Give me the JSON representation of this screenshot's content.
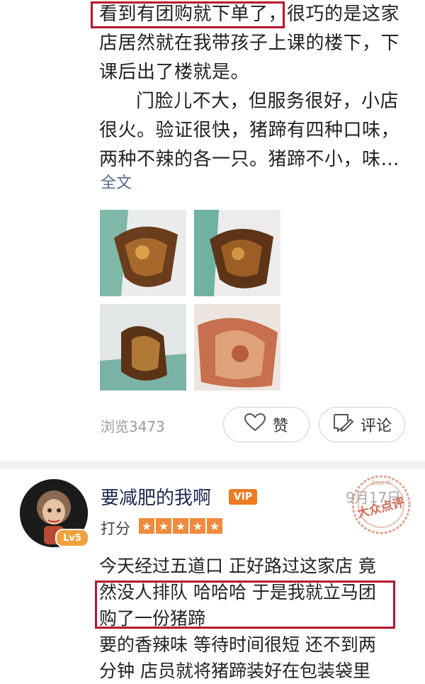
{
  "review": {
    "line1": "看到有团购就下单了，很巧的是这家",
    "line2": "店居然就在我带孩子上课的楼下，下",
    "line3": "课后出了楼就是。",
    "line4": "门脸儿不大，但服务很好，小店",
    "line5": "很火。验证很快，猪蹄有四种口味，",
    "line6": "两种不辣的各一只。猪蹄不小，味…",
    "full_text_link": "全文",
    "views": "浏览3473",
    "like_label": "赞",
    "comment_label": "评论"
  },
  "next_review": {
    "username": "要减肥的我啊",
    "vip_badge": "VIP",
    "level_badge": "Lv5",
    "date": "9月17日",
    "stamp_text": "大众点评",
    "stamp_top": "Dian Pi",
    "rating_label": "打分",
    "stars": 5,
    "line1": "今天经过五道口 正好路过这家店 竟",
    "line2": "然没人排队 哈哈哈 于是我就立马团",
    "line3": "购了一份猪蹄",
    "line4": "要的香辣味 等待时间很短 还不到两",
    "line5": "分钟 店员就将猪蹄装好在包装袋里"
  },
  "colors": {
    "highlight": "#b5162b",
    "link": "#5a6b8a",
    "vip": "#f07a22",
    "star": "#f08a3c"
  }
}
